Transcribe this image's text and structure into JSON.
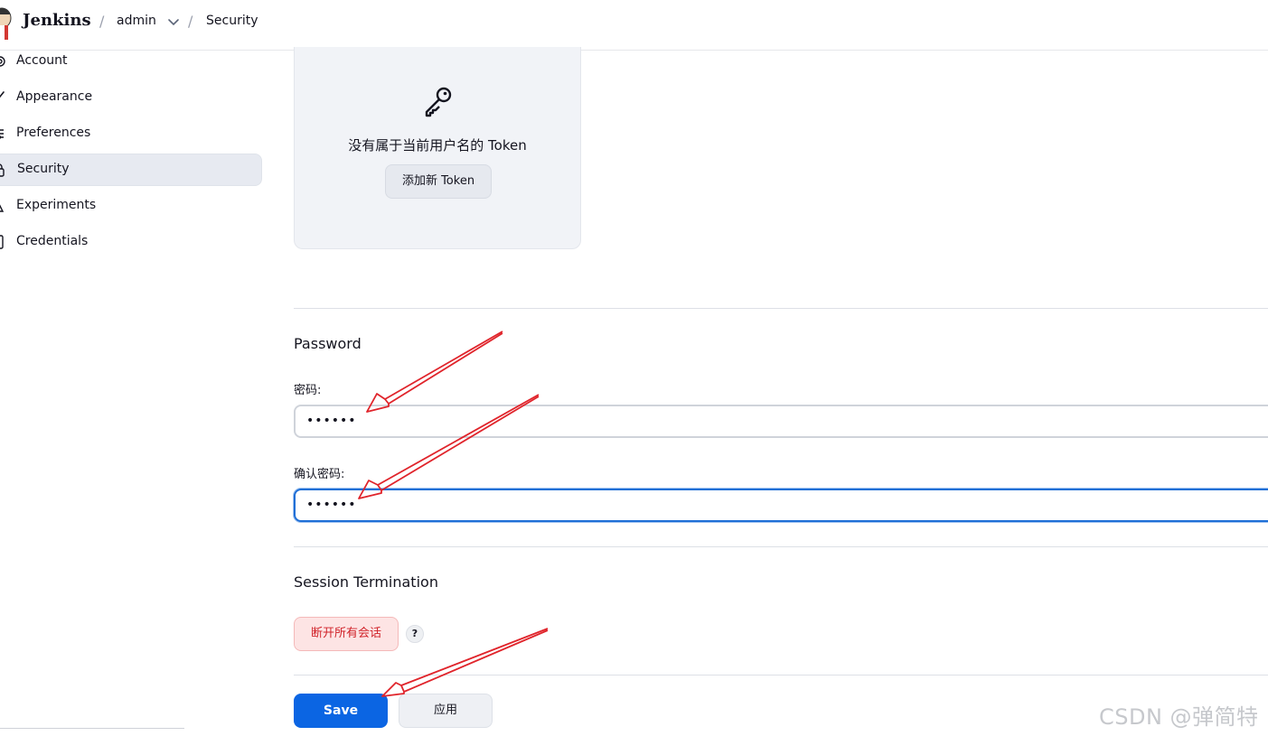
{
  "header": {
    "brand": "Jenkins",
    "breadcrumb": [
      "admin",
      "Security"
    ],
    "separator": "/"
  },
  "sidebar": {
    "items": [
      {
        "label": "Account",
        "icon": "gear-icon"
      },
      {
        "label": "Appearance",
        "icon": "brush-icon"
      },
      {
        "label": "Preferences",
        "icon": "sliders-icon"
      },
      {
        "label": "Security",
        "icon": "lock-icon",
        "active": true
      },
      {
        "label": "Experiments",
        "icon": "flask-icon"
      },
      {
        "label": "Credentials",
        "icon": "id-card-icon"
      }
    ]
  },
  "token": {
    "empty_message": "没有属于当前用户名的 Token",
    "add_button": "添加新 Token"
  },
  "password": {
    "section_title": "Password",
    "password_label": "密码:",
    "password_value": "••••••",
    "confirm_label": "确认密码:",
    "confirm_value": "••••••"
  },
  "session": {
    "section_title": "Session Termination",
    "terminate_button": "断开所有会话",
    "help": "?"
  },
  "footer": {
    "save_button": "Save",
    "apply_button": "应用"
  },
  "watermark": "CSDN @弹简特",
  "colors": {
    "primary": "#0b65e3",
    "danger": "#d1232a",
    "focus": "#1f6fd6",
    "annotation": "#e0242b"
  }
}
